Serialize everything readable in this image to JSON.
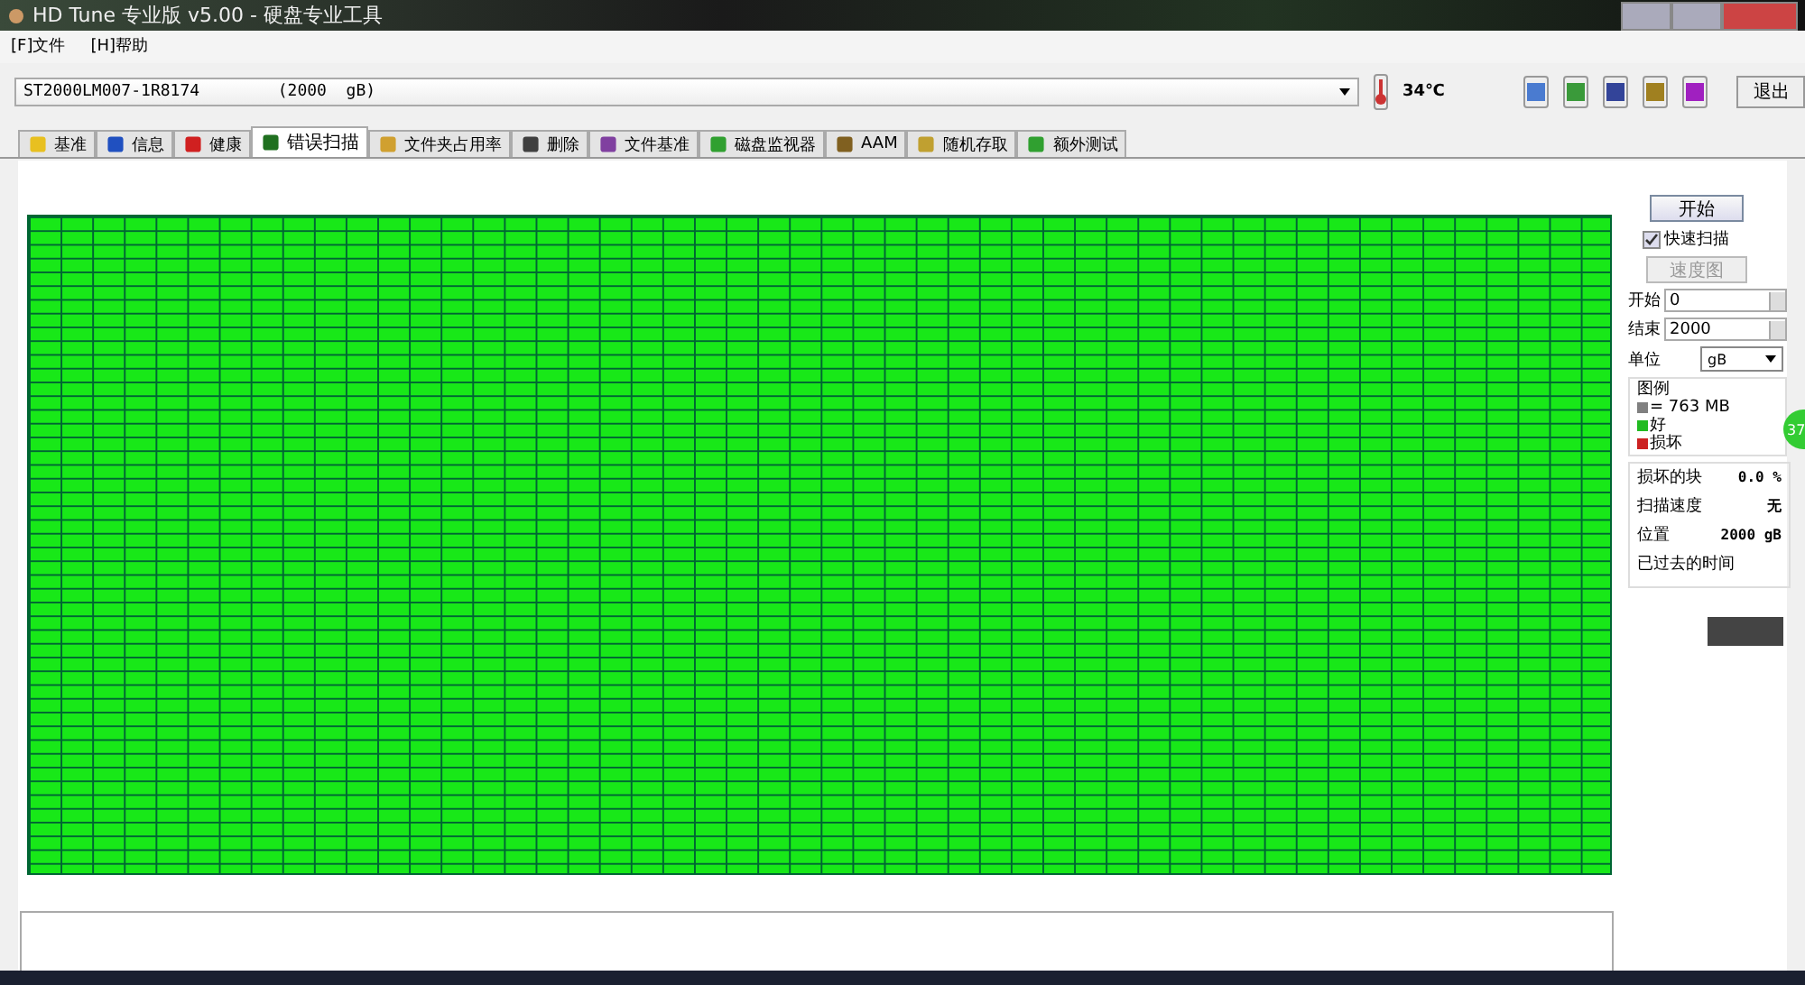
{
  "window": {
    "title": "HD Tune 专业版 v5.00 - 硬盘专业工具"
  },
  "menu": [
    "[F]文件",
    "[H]帮助"
  ],
  "drive": {
    "value": "ST2000LM007-1R8174        (2000  gB)"
  },
  "temperature": "34℃",
  "exit_button": "退出",
  "tabs": [
    {
      "label": "基准",
      "selected": false
    },
    {
      "label": "信息",
      "selected": false
    },
    {
      "label": "健康",
      "selected": false
    },
    {
      "label": "错误扫描",
      "selected": true
    },
    {
      "label": "文件夹占用率",
      "selected": false
    },
    {
      "label": "删除",
      "selected": false
    },
    {
      "label": "文件基准",
      "selected": false
    },
    {
      "label": "磁盘监视器",
      "selected": false
    },
    {
      "label": "AAM",
      "selected": false
    },
    {
      "label": "随机存取",
      "selected": false
    },
    {
      "label": "额外测试",
      "selected": false
    }
  ],
  "panel": {
    "start_button": "开始",
    "quick_scan": {
      "label": "快速扫描",
      "checked": true
    },
    "speed_map_button": {
      "label": "速度图",
      "disabled": true
    },
    "start_field": {
      "label": "开始",
      "value": "0"
    },
    "end_field": {
      "label": "结束",
      "value": "2000"
    },
    "unit": {
      "label": "单位",
      "value": "gB"
    },
    "legend": {
      "title": "图例",
      "items": [
        {
          "label": "= 763 MB",
          "color": "#808080"
        },
        {
          "label": "好",
          "color": "#22bb22"
        },
        {
          "label": "损坏",
          "color": "#cc2222"
        }
      ]
    },
    "stats": [
      {
        "label": "损坏的块",
        "value": "0.0 %"
      },
      {
        "label": "扫描速度",
        "value": "无"
      },
      {
        "label": "位置",
        "value": "2000 gB"
      },
      {
        "label": "已过去的时间"
      }
    ]
  },
  "overlay_badge": "37"
}
